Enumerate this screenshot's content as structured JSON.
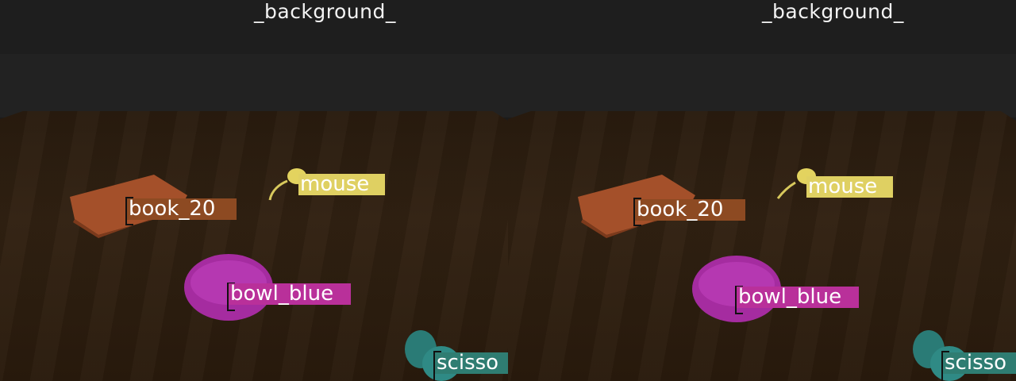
{
  "views": [
    {
      "background_label": "_background_",
      "objects": {
        "book": {
          "label": "book_20",
          "color": "#8d4a22"
        },
        "mouse": {
          "label": "mouse",
          "color": "#dfd062"
        },
        "bowl": {
          "label": "bowl_blue",
          "color": "#b9309a"
        },
        "scissors": {
          "label": "scisso",
          "color": "#2f7d72"
        }
      }
    },
    {
      "background_label": "_background_",
      "objects": {
        "book": {
          "label": "book_20",
          "color": "#8d4a22"
        },
        "mouse": {
          "label": "mouse",
          "color": "#dfd062"
        },
        "bowl": {
          "label": "bowl_blue",
          "color": "#b9309a"
        },
        "scissors": {
          "label": "scisso",
          "color": "#2f7d72"
        }
      }
    }
  ]
}
